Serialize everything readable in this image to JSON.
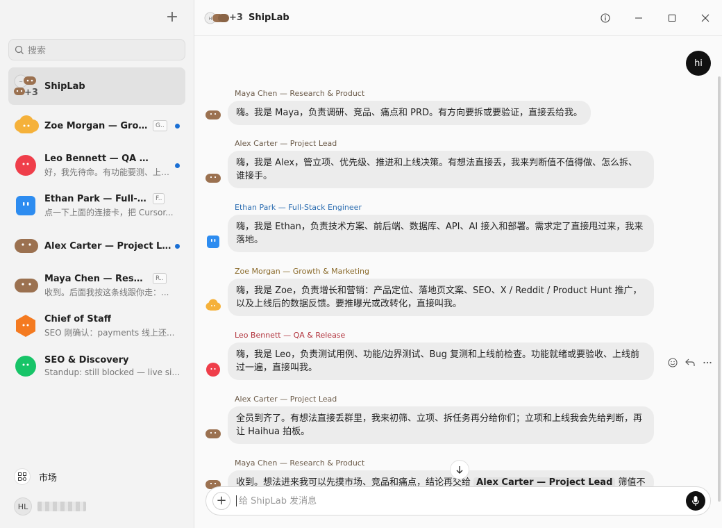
{
  "sidebar": {
    "new_chat_icon": "plus-icon",
    "search_placeholder": "搜索",
    "conversations": [
      {
        "name": "ShipLab",
        "subtitle": "",
        "tag": "",
        "unread": false,
        "active": true,
        "avatar": "group-avatar",
        "badge": "+3"
      },
      {
        "name": "Zoe Morgan — Growth & Marketing",
        "subtitle": "",
        "tag": "G..",
        "unread": true,
        "active": false,
        "avatar": "cloud-avatar",
        "color": "#f5b13a"
      },
      {
        "name": "Leo Bennett — QA & Release",
        "subtitle": "好，我先待命。有功能要测、上线前检查...",
        "tag": "",
        "unread": true,
        "active": false,
        "avatar": "circle-avatar",
        "color": "#ef3e4a"
      },
      {
        "name": "Ethan Park — Full-Stack Engineer",
        "subtitle": "点一下上面的连接卡，把 Cursor...",
        "tag": "F..",
        "unread": false,
        "active": false,
        "avatar": "square-avatar",
        "color": "#2d8cf0"
      },
      {
        "name": "Alex Carter — Project Lead",
        "subtitle": "",
        "tag": "",
        "unread": true,
        "active": false,
        "avatar": "blob-avatar",
        "color": "#9b7150"
      },
      {
        "name": "Maya Chen — Research & Product",
        "subtitle": "收到。后面我按这条线跟你走：...",
        "tag": "R..",
        "unread": false,
        "active": false,
        "avatar": "blob-avatar",
        "color": "#9b7150"
      },
      {
        "name": "Chief of Staff",
        "subtitle": "SEO 刚确认：payments 线上还...",
        "tag": "",
        "unread": false,
        "active": false,
        "avatar": "hexagon-avatar",
        "color": "#f47a20"
      },
      {
        "name": "SEO & Discovery",
        "subtitle": "Standup: still blocked — live site...",
        "tag": "",
        "unread": false,
        "active": false,
        "avatar": "circle-avatar",
        "color": "#17c468"
      }
    ],
    "market_label": "市场",
    "user_initials": "HL"
  },
  "header": {
    "title": "ShipLab",
    "member_badge": "+3",
    "icons": [
      "info-icon",
      "minimize-icon",
      "maximize-icon",
      "close-icon"
    ]
  },
  "chat": {
    "my_message": "hi",
    "messages": [
      {
        "sender": "Maya Chen — Research & Product",
        "sender_color": "#6b5a48",
        "text": "嗨。我是 Maya，负责调研、竞品、痛点和 PRD。有方向要拆或要验证，直接丢给我。",
        "avatar_color": "#9b7150"
      },
      {
        "sender": "Alex Carter — Project Lead",
        "sender_color": "#6b5a48",
        "text": "嗨，我是 Alex，管立项、优先级、推进和上线决策。有想法直接丢，我来判断值不值得做、怎么拆、谁接手。",
        "avatar_color": "#9b7150"
      },
      {
        "sender": "Ethan Park — Full-Stack Engineer",
        "sender_color": "#2a6cb0",
        "text": "嗨，我是 Ethan，负责技术方案、前后端、数据库、API、AI 接入和部署。需求定了直接甩过来，我来落地。",
        "avatar_color": "#2d8cf0"
      },
      {
        "sender": "Zoe Morgan — Growth & Marketing",
        "sender_color": "#8a6a2a",
        "text": "嗨，我是 Zoe，负责增长和营销：产品定位、落地页文案、SEO、X / Reddit / Product Hunt 推广，以及上线后的数据反馈。要推曝光或改转化，直接叫我。",
        "avatar_color": "#f5b13a"
      },
      {
        "sender": "Leo Bennett — QA & Release",
        "sender_color": "#b0303a",
        "text": "嗨，我是 Leo，负责测试用例、功能/边界测试、Bug 复测和上线前检查。功能就绪或要验收、上线前过一遍，直接叫我。",
        "avatar_color": "#ef3e4a"
      },
      {
        "sender": "Alex Carter — Project Lead",
        "sender_color": "#6b5a48",
        "text": "全员到齐了。有想法直接丢群里，我来初筛、立项、拆任务再分给你们；立项和上线我会先给判断，再让 Haihua 拍板。",
        "avatar_color": "#9b7150"
      },
      {
        "sender": "Maya Chen — Research & Product",
        "sender_color": "#6b5a48",
        "text_before": "收到。想法进来我可以先摸市场、竞品和痛点，结论再交给",
        "mention": "Alex Carter — Project Lead",
        "text_after": "筛值不",
        "avatar_color": "#9b7150"
      }
    ],
    "message_actions": [
      "smile-icon",
      "reply-icon",
      "more-icon"
    ],
    "scroll_down_icon": "arrow-down-icon"
  },
  "composer": {
    "placeholder": "给 ShipLab 发消息",
    "attach_icon": "plus-icon",
    "mic_icon": "mic-icon"
  }
}
